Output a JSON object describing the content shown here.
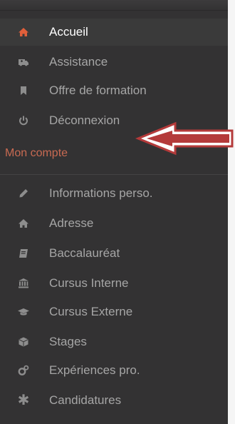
{
  "nav": {
    "items": [
      {
        "label": "Accueil",
        "icon": "home-icon",
        "active": true
      },
      {
        "label": "Assistance",
        "icon": "ambulance-icon",
        "active": false
      },
      {
        "label": "Offre de formation",
        "icon": "bookmark-icon",
        "active": false
      },
      {
        "label": "Déconnexion",
        "icon": "power-icon",
        "active": false
      }
    ]
  },
  "account": {
    "title": "Mon compte",
    "items": [
      {
        "label": "Informations perso.",
        "icon": "pencil-icon"
      },
      {
        "label": "Adresse",
        "icon": "home-icon"
      },
      {
        "label": "Baccalauréat",
        "icon": "book-icon"
      },
      {
        "label": "Cursus Interne",
        "icon": "institution-icon"
      },
      {
        "label": "Cursus Externe",
        "icon": "graduation-cap-icon"
      },
      {
        "label": "Stages",
        "icon": "cube-icon"
      },
      {
        "label": "Expériences pro.",
        "icon": "cogs-icon"
      },
      {
        "label": "Candidatures",
        "icon": "asterisk-icon"
      }
    ]
  },
  "colors": {
    "sidebar_bg": "#333233",
    "active_accent": "#e05f3a",
    "section_title": "#c86a52",
    "arrow": "#b43a3a"
  }
}
